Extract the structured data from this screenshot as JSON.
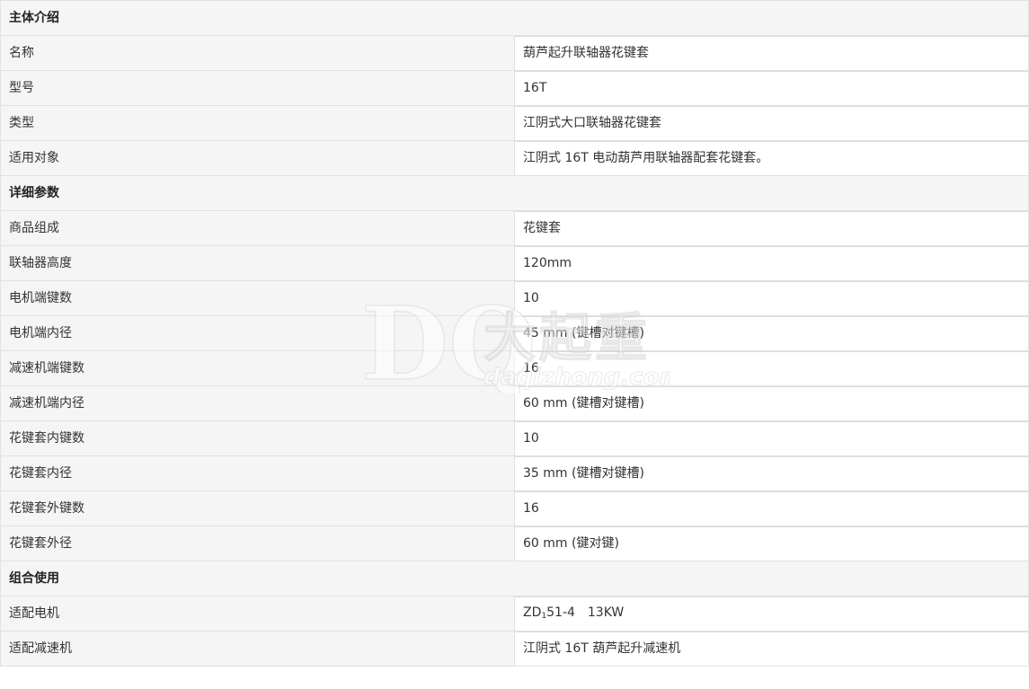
{
  "sections": [
    {
      "title": "主体介绍",
      "rows": [
        {
          "label": "名称",
          "value": "葫芦起升联轴器花键套"
        },
        {
          "label": "型号",
          "value": "16T"
        },
        {
          "label": "类型",
          "value": "江阴式大口联轴器花键套"
        },
        {
          "label": "适用对象",
          "value": "江阴式 16T 电动葫芦用联轴器配套花键套。"
        }
      ]
    },
    {
      "title": "详细参数",
      "rows": [
        {
          "label": "商品组成",
          "value": "花键套"
        },
        {
          "label": "联轴器高度",
          "value": "120mm"
        },
        {
          "label": "电机端键数",
          "value": "10"
        },
        {
          "label": "电机端内径",
          "value": "45 mm (键槽对键槽)"
        },
        {
          "label": "减速机端键数",
          "value": "16"
        },
        {
          "label": "减速机端内径",
          "value": "60 mm (键槽对键槽)"
        },
        {
          "label": "花键套内键数",
          "value": "10"
        },
        {
          "label": "花键套内径",
          "value": "35 mm (键槽对键槽)"
        },
        {
          "label": "花键套外键数",
          "value": "16"
        },
        {
          "label": "花键套外径",
          "value": "60 mm (键对键)"
        }
      ]
    },
    {
      "title": "组合使用",
      "rows": [
        {
          "label": "适配电机",
          "value_parts": {
            "prefix": "ZD",
            "sub": "1",
            "model": "51-4",
            "power": "13KW"
          }
        },
        {
          "label": "适配减速机",
          "value": "江阴式 16T 葫芦起升减速机"
        }
      ]
    }
  ],
  "watermark": {
    "logo_letters": "DQ",
    "cn_text": "大起重",
    "en_text": "daqizhong.com"
  }
}
